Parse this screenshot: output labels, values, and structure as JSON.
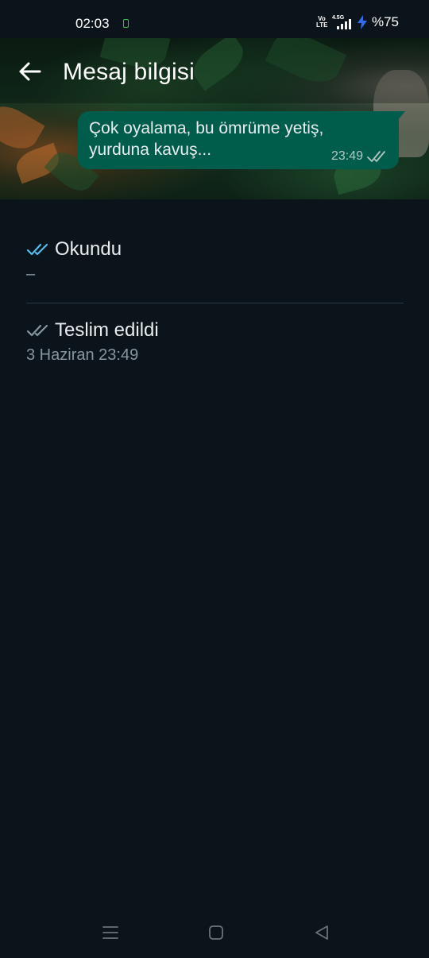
{
  "status_bar": {
    "time": "02:03",
    "volte_label": "Vo LTE",
    "network_type": "4.5G",
    "battery": "%75"
  },
  "header": {
    "title": "Mesaj bilgisi"
  },
  "message": {
    "text": "Çok oyalama, bu ömrüme yetiş, yurduna kavuş...",
    "time": "23:49"
  },
  "receipts": [
    {
      "label": "Okundu",
      "value": "–",
      "tick_color": "#53bdeb"
    },
    {
      "label": "Teslim edildi",
      "value": "3 Haziran 23:49",
      "tick_color": "#8696a0"
    }
  ],
  "nav_bar": {
    "menu_icon": "menu-icon",
    "home_icon": "home-icon",
    "back_icon": "back-triangle-icon"
  },
  "colors": {
    "background": "#0b141a",
    "bubble": "#005c4b",
    "read_tick": "#53bdeb",
    "delivered_tick": "#8696a0",
    "secondary_text": "#8696a0"
  }
}
